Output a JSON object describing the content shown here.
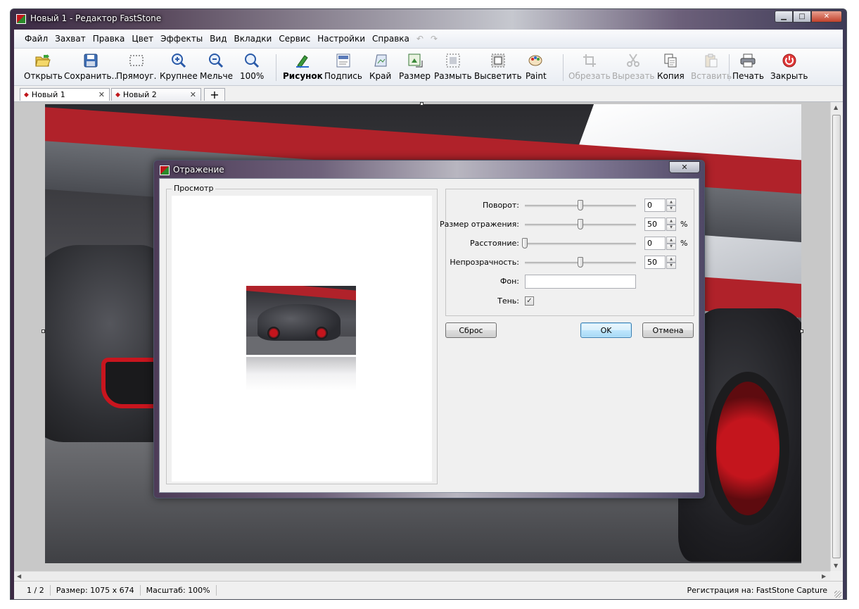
{
  "window": {
    "title": "Новый 1 - Редактор FastStone"
  },
  "menu": {
    "items": [
      "Файл",
      "Захват",
      "Правка",
      "Цвет",
      "Эффекты",
      "Вид",
      "Вкладки",
      "Сервис",
      "Настройки",
      "Справка"
    ],
    "undo_glyph": "↶",
    "redo_glyph": "↷"
  },
  "toolbar": {
    "open": "Открыть",
    "save": "Сохранить..",
    "rect": "Прямоуг.",
    "zoom_in": "Крупнее",
    "zoom_out": "Мельче",
    "zoom_100": "100%",
    "draw": "Рисунок",
    "caption": "Подпись",
    "edge": "Край",
    "resize": "Размер",
    "blur": "Размыть",
    "spotlight": "Высветить",
    "paint": "Paint",
    "crop": "Обрезать",
    "cut": "Вырезать",
    "copy": "Копия",
    "paste": "Вставить",
    "print": "Печать",
    "close": "Закрыть"
  },
  "tabs": [
    {
      "label": "Новый 1",
      "close": "✕"
    },
    {
      "label": "Новый 2",
      "close": "✕"
    }
  ],
  "add_tab": "+",
  "status": {
    "page": "1 / 2",
    "size": "Размер: 1075 x 674",
    "zoom": "Масштаб: 100%",
    "registration": "Регистрация на: FastStone Capture"
  },
  "dialog": {
    "title": "Отражение",
    "close": "✕",
    "preview_label": "Просмотр",
    "rotation": {
      "label": "Поворот:",
      "value": "0",
      "level": 0.5
    },
    "reflection_size": {
      "label": "Размер отражения:",
      "value": "50",
      "unit": "%",
      "level": 0.5
    },
    "distance": {
      "label": "Расстояние:",
      "value": "0",
      "unit": "%",
      "level": 0.0
    },
    "opacity": {
      "label": "Непрозрачность:",
      "value": "50",
      "level": 0.5
    },
    "background": {
      "label": "Фон:"
    },
    "shadow": {
      "label": "Тень:",
      "checked": true
    },
    "reset_button": "Сброс",
    "ok_button": "OK",
    "cancel_button": "Отмена"
  }
}
